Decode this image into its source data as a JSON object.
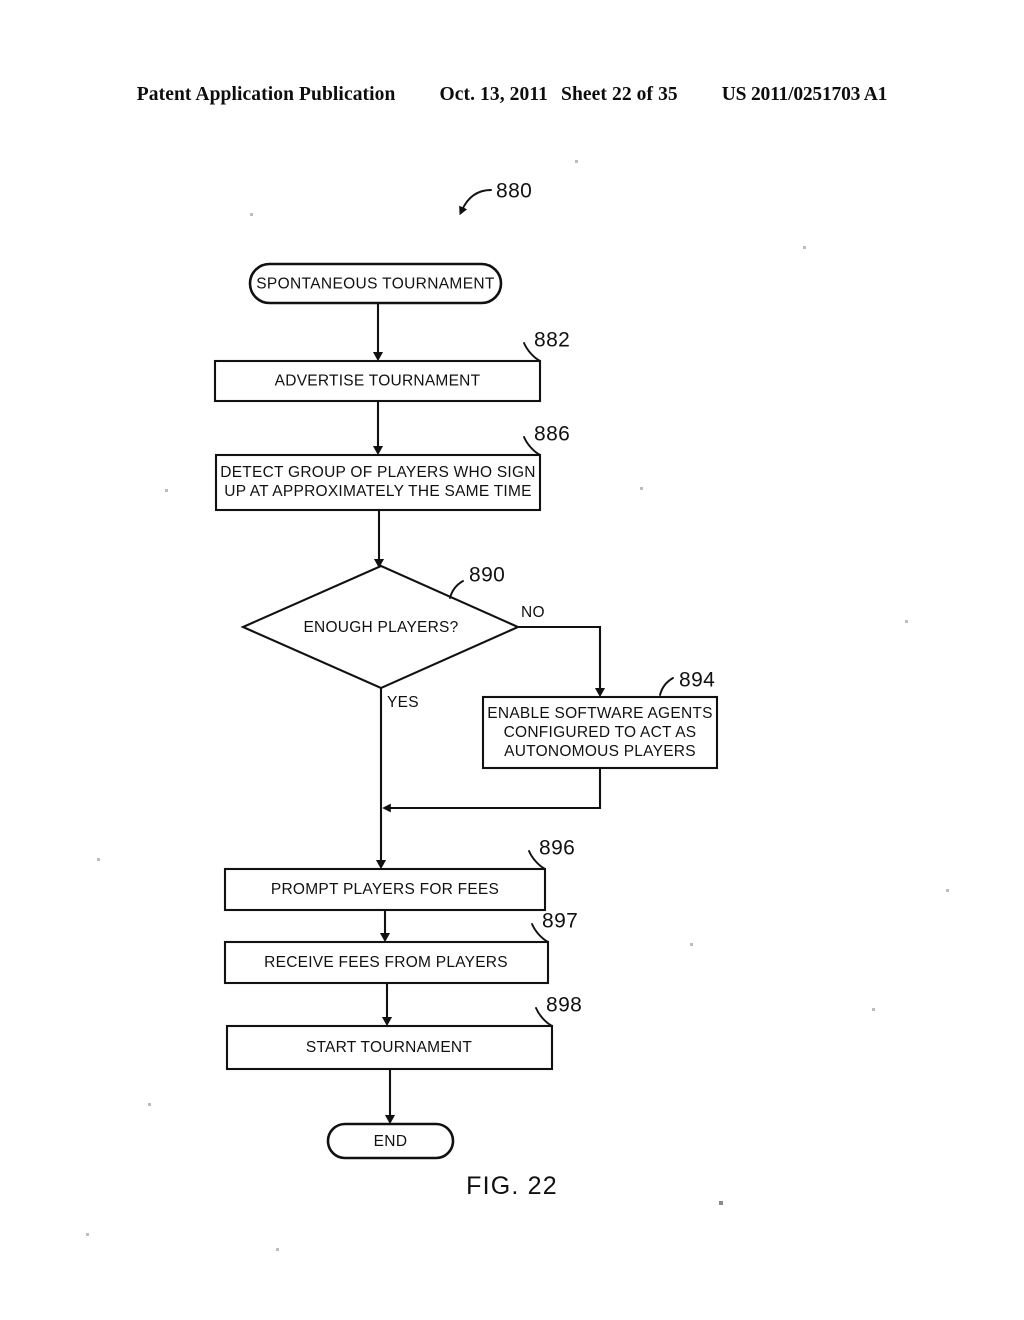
{
  "header": {
    "publication": "Patent Application Publication",
    "date": "Oct. 13, 2011",
    "sheet": "Sheet 22 of 35",
    "document_number": "US 2011/0251703 A1"
  },
  "figure": {
    "caption": "FIG. 22",
    "diagram_ref": "880",
    "type": "flowchart"
  },
  "nodes": {
    "start": {
      "ref": "880",
      "shape": "terminator",
      "label": "SPONTANEOUS TOURNAMENT"
    },
    "advertise": {
      "ref": "882",
      "shape": "process",
      "label": "ADVERTISE TOURNAMENT",
      "lines": [
        "ADVERTISE TOURNAMENT"
      ]
    },
    "detect": {
      "ref": "886",
      "shape": "process",
      "label": "DETECT GROUP OF PLAYERS WHO SIGN UP AT APPROXIMATELY THE SAME TIME",
      "line1": "DETECT GROUP OF PLAYERS WHO SIGN",
      "line2": "UP AT APPROXIMATELY THE SAME TIME"
    },
    "decision": {
      "ref": "890",
      "shape": "decision",
      "label": "ENOUGH PLAYERS?",
      "branch_yes": "YES",
      "branch_no": "NO"
    },
    "agents": {
      "ref": "894",
      "shape": "process",
      "label": "ENABLE SOFTWARE AGENTS CONFIGURED TO ACT AS AUTONOMOUS PLAYERS",
      "line1": "ENABLE SOFTWARE AGENTS",
      "line2": "CONFIGURED TO ACT AS",
      "line3": "AUTONOMOUS PLAYERS"
    },
    "prompt_fees": {
      "ref": "896",
      "shape": "process",
      "label": "PROMPT PLAYERS FOR FEES"
    },
    "receive_fees": {
      "ref": "897",
      "shape": "process",
      "label": "RECEIVE FEES FROM PLAYERS"
    },
    "start_tournament": {
      "ref": "898",
      "shape": "process",
      "label": "START TOURNAMENT"
    },
    "end": {
      "shape": "terminator",
      "label": "END"
    }
  },
  "colors": {
    "ink": "#111111",
    "paper": "#ffffff"
  }
}
